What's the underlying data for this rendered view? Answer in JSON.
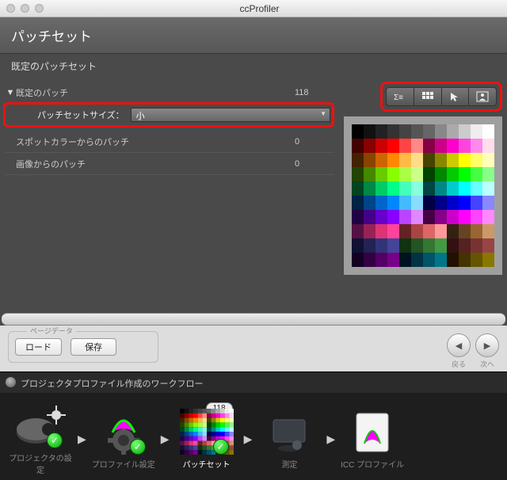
{
  "window": {
    "title": "ccProfiler"
  },
  "header": {
    "title": "パッチセット",
    "subtitle": "既定のパッチセット"
  },
  "rows": {
    "default_patch": {
      "label": "既定のパッチ",
      "value": "118"
    },
    "spot": {
      "label": "スポットカラーからのパッチ",
      "value": "0"
    },
    "image": {
      "label": "画像からのパッチ",
      "value": "0"
    }
  },
  "size_selector": {
    "label": "パッチセットサイズ：",
    "value": "小"
  },
  "view_icons": [
    "list-sigma-icon",
    "grid-icon",
    "cursor-icon",
    "person-icon"
  ],
  "pagebar": {
    "group": "ページデータ",
    "load": "ロード",
    "save": "保存",
    "back": "戻る",
    "next": "次へ"
  },
  "workflow": {
    "title": "プロジェクタプロファイル作成のワークフロー",
    "badge": "118",
    "steps": [
      {
        "label": "プロジェクタの設定",
        "done": true,
        "active": false
      },
      {
        "label": "プロファイル設定",
        "done": true,
        "active": false
      },
      {
        "label": "パッチセット",
        "done": true,
        "active": true
      },
      {
        "label": "測定",
        "done": false,
        "active": false
      },
      {
        "label": "ICC プロファイル",
        "done": false,
        "active": false
      }
    ]
  },
  "swatch_colors": [
    "#000",
    "#111",
    "#222",
    "#333",
    "#444",
    "#555",
    "#666",
    "#888",
    "#aaa",
    "#ccc",
    "#eee",
    "#fff",
    "#400",
    "#800",
    "#c00",
    "#f00",
    "#f44",
    "#f88",
    "#804",
    "#c08",
    "#f0c",
    "#f4d",
    "#f8e",
    "#fde",
    "#420",
    "#840",
    "#c60",
    "#f80",
    "#fb4",
    "#fd8",
    "#440",
    "#880",
    "#cc0",
    "#ff0",
    "#ff6",
    "#ffb",
    "#240",
    "#480",
    "#6c0",
    "#8f0",
    "#af4",
    "#cf8",
    "#040",
    "#080",
    "#0c0",
    "#0f0",
    "#4f4",
    "#8f8",
    "#042",
    "#084",
    "#0c6",
    "#0f8",
    "#4fb",
    "#8fd",
    "#044",
    "#088",
    "#0cc",
    "#0ff",
    "#6ff",
    "#bff",
    "#024",
    "#048",
    "#06c",
    "#08f",
    "#4bf",
    "#8df",
    "#004",
    "#008",
    "#00c",
    "#00f",
    "#44f",
    "#88f",
    "#204",
    "#408",
    "#60c",
    "#80f",
    "#b4f",
    "#d8f",
    "#404",
    "#808",
    "#c0c",
    "#f0f",
    "#f4f",
    "#f8f",
    "#514",
    "#925",
    "#d37",
    "#f49",
    "#622",
    "#a44",
    "#d66",
    "#f99",
    "#321",
    "#642",
    "#963",
    "#c96",
    "#113",
    "#225",
    "#337",
    "#449",
    "#131",
    "#252",
    "#373",
    "#494",
    "#311",
    "#522",
    "#733",
    "#944",
    "#102",
    "#304",
    "#506",
    "#708",
    "#012",
    "#034",
    "#056",
    "#078",
    "#210",
    "#430",
    "#650",
    "#870"
  ]
}
